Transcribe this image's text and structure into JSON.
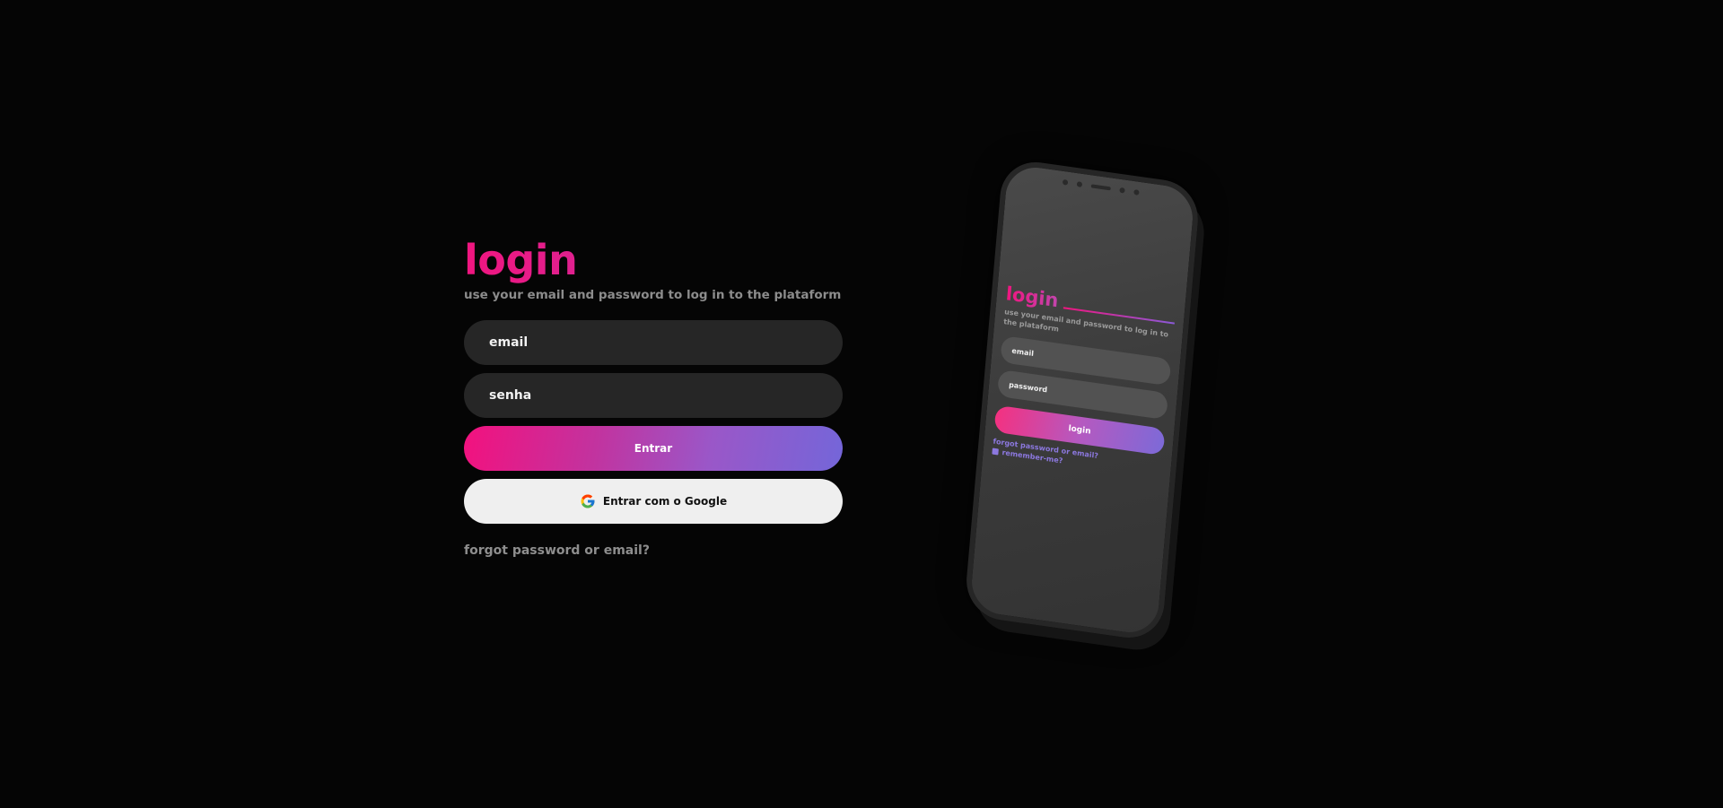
{
  "login": {
    "title": "login",
    "subtitle": "use your email and password to log in to the plataform",
    "email_placeholder": "email",
    "password_placeholder": "senha",
    "submit_label": "Entrar",
    "google_label": "Entrar com o Google",
    "forgot_label": "forgot password or email?"
  },
  "phone": {
    "title": "login",
    "subtitle": "use your email and password to log in to the plataform",
    "email_label": "email",
    "password_label": "password",
    "submit_label": "login",
    "forgot_label": "forgot password or email?",
    "remember_label": "remember-me?"
  },
  "colors": {
    "background": "#050505",
    "accent_pink": "#f0157f",
    "accent_purple": "#7466d9",
    "field_bg": "#262626",
    "google_btn_bg": "#efefef"
  },
  "icons": {
    "google": "google-icon"
  }
}
